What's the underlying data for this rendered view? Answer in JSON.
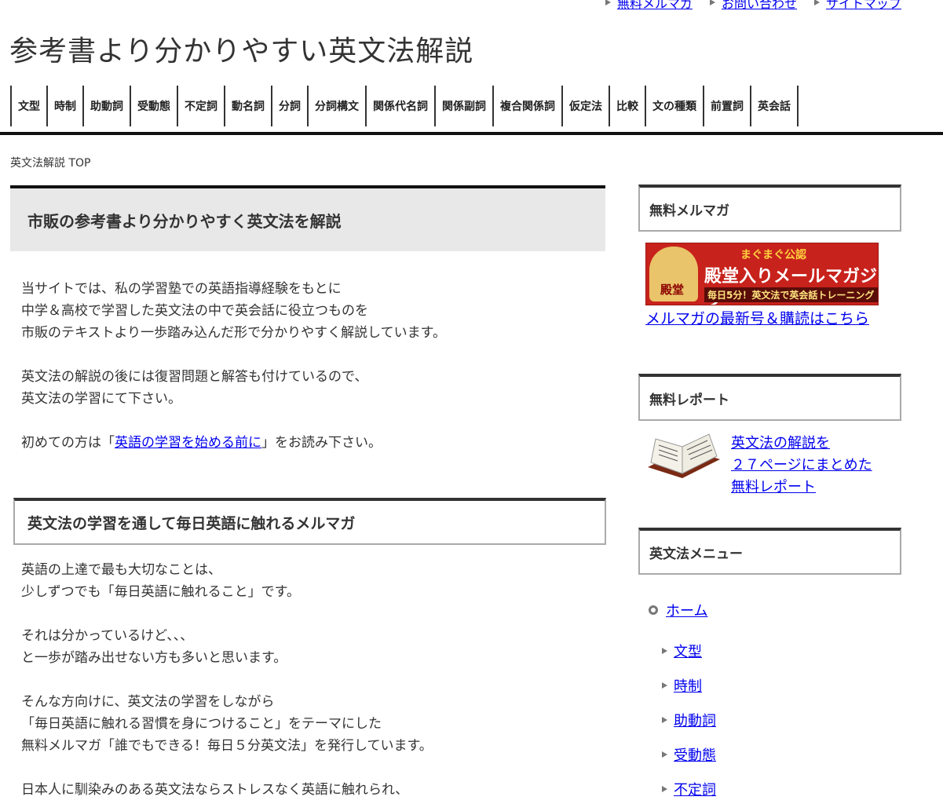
{
  "top_links": [
    "無料メルマガ",
    "お問い合わせ",
    "サイトマップ"
  ],
  "site_title": "参考書より分かりやすい英文法解説",
  "nav": [
    "文型",
    "時制",
    "助動詞",
    "受動態",
    "不定詞",
    "動名詞",
    "分詞",
    "分詞構文",
    "関係代名詞",
    "関係副詞",
    "複合関係詞",
    "仮定法",
    "比較",
    "文の種類",
    "前置詞",
    "英会話"
  ],
  "breadcrumb": "英文法解説 TOP",
  "main": {
    "h1": "市販の参考書より分かりやすく英文法を解説",
    "intro_lines": [
      "当サイトでは、私の学習塾での英語指導経験をもとに",
      "中学＆高校で学習した英文法の中で英会話に役立つものを",
      "市販のテキストより一歩踏み込んだ形で分かりやすく解説しています。"
    ],
    "review_lines": [
      "英文法の解説の後には復習問題と解答も付けているので、",
      "英文法の学習にて下さい。"
    ],
    "first_prefix": "初めての方は「",
    "first_link": "英語の学習を始める前に",
    "first_suffix": "」をお読み下さい。",
    "h2": "英文法の学習を通して毎日英語に触れるメルマガ",
    "p1": [
      "英語の上達で最も大切なことは、",
      "少しずつでも「毎日英語に触れること」です。"
    ],
    "p2": [
      "それは分かっているけど、、、",
      "と一歩が踏み出せない方も多いと思います。"
    ],
    "p3": [
      "そんな方向けに、英文法の学習をしながら",
      "「毎日英語に触れる習慣を身につけること」をテーマにした",
      "無料メルマガ「誰でもできる！毎日５分英文法」を発行しています。"
    ],
    "p4": [
      "日本人に馴染みのある英文法ならストレスなく英語に触れられ、"
    ]
  },
  "sidebar": {
    "mailmag_title": "無料メルマガ",
    "banner_small": "まぐまぐ公認",
    "banner_big": "殿堂入りメールマガジン",
    "banner_sub": "毎日5分！英文法で英会話トレーニング",
    "banner_face_text": "殿堂",
    "mailmag_link": "メルマガの最新号＆購読はこちら",
    "report_title": "無料レポート",
    "report_links": [
      "英文法の解説を",
      "２７ページにまとめた",
      "無料レポート"
    ],
    "menu_title": "英文法メニュー",
    "menu_home": "ホーム",
    "menu_items": [
      "文型",
      "時制",
      "助動詞",
      "受動態",
      "不定詞"
    ]
  }
}
